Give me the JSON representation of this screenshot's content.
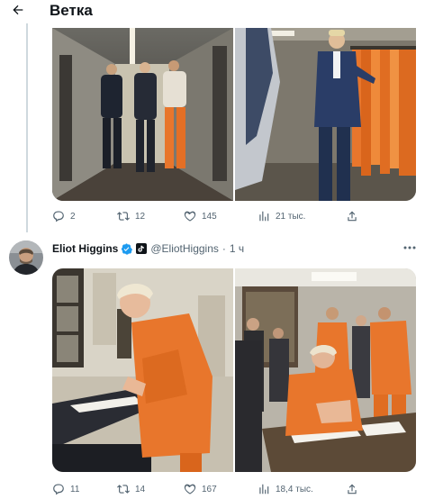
{
  "header": {
    "back_icon": "arrow-left-icon",
    "title": "Ветка"
  },
  "tweet1": {
    "actions": {
      "replies": "2",
      "retweets": "12",
      "likes": "145",
      "views": "21 тыс."
    }
  },
  "tweet2": {
    "author_name": "Eliot Higgins",
    "handle": "@EliotHiggins",
    "separator": "·",
    "time": "1 ч",
    "actions": {
      "replies": "11",
      "retweets": "14",
      "likes": "167",
      "views": "18,4 тыс."
    }
  },
  "colors": {
    "text_primary": "#0f1419",
    "text_secondary": "#536471",
    "verified_blue": "#1d9bf0",
    "thread_line": "#cfd9de",
    "prison_orange": "#e8762c"
  }
}
